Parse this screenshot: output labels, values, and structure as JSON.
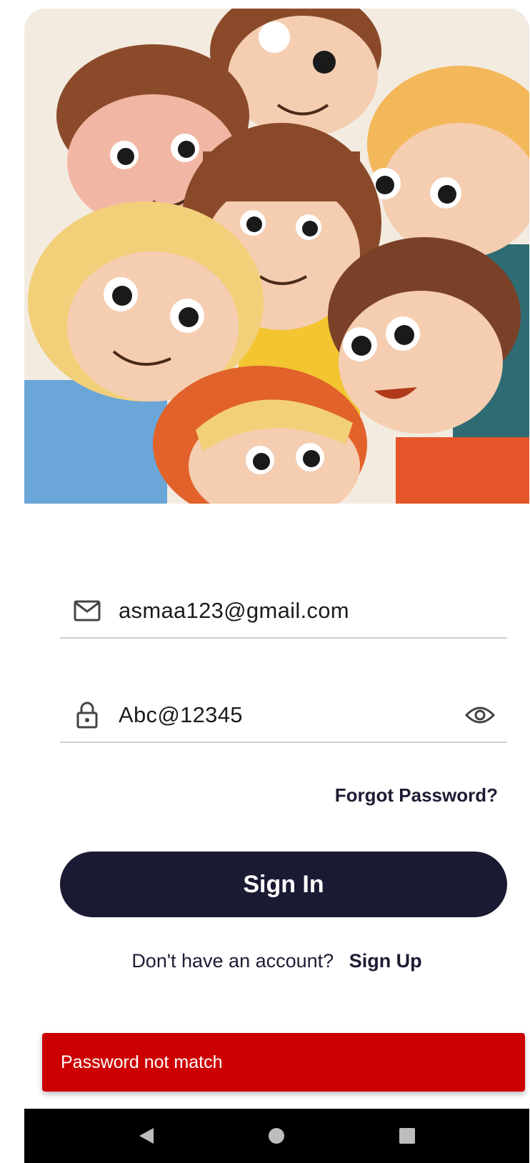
{
  "login": {
    "email_value": "asmaa123@gmail.com",
    "password_value": "Abc@12345",
    "forgot_label": "Forgot Password?",
    "signin_label": "Sign In",
    "signup_prompt": "Don't have an account?",
    "signup_link": "Sign Up"
  },
  "snackbar": {
    "message": "Password not match",
    "color": "#cc0000"
  },
  "icons": {
    "email": "mail-icon",
    "password": "lock-icon",
    "visibility": "eye-icon",
    "nav_back": "back-triangle-icon",
    "nav_home": "home-circle-icon",
    "nav_recents": "recents-square-icon"
  },
  "colors": {
    "primary": "#1b1a33",
    "error": "#cc0000",
    "divider": "#cfcfcf"
  }
}
